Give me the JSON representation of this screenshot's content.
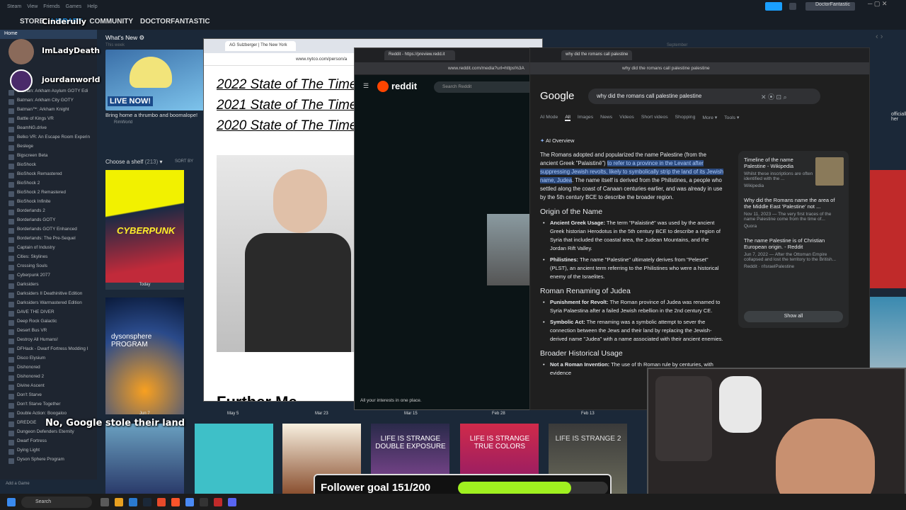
{
  "steam": {
    "menu": [
      "Steam",
      "View",
      "Friends",
      "Games",
      "Help"
    ],
    "nav": [
      "STORE",
      "LIBRARY",
      "COMMUNITY",
      "DOCTORFANTASTIC"
    ],
    "user": "DoctorFantastic",
    "home": "Home",
    "whats_new": "What's New ⚙",
    "this_week": "This week",
    "news_caption": "Bring home a thrumbo and boomalope!",
    "news_sub": "RimWorld",
    "live": "LIVE NOW!",
    "shelf": "Choose a shelf",
    "shelf_count": "(213)",
    "sort_by": "SORT BY",
    "month_labels": [
      "This week",
      "September"
    ],
    "dates": [
      "Today",
      "Jun 7",
      "May 5",
      "Mar 23",
      "Mar 15",
      "Feb 28",
      "Feb 13"
    ],
    "tile_titles": [
      "CYBERPUNK",
      "dysonsphere PROGRAM",
      "LIFE IS STRANGE DOUBLE EXPOSURE",
      "LIFE IS STRANGE TRUE COLORS",
      "LIFE IS STRANGE 2"
    ],
    "officially": "officially her",
    "add_game": "Add a Game",
    "games": [
      "Batman: Arkham Asylum GOTY Edi",
      "Batman: Arkham City GOTY",
      "Batman™: Arkham Knight",
      "Battle of Kings VR",
      "BeamNG.drive",
      "Belko VR: An Escape Room Experin",
      "Beslege",
      "Bigscreen Beta",
      "BioShock",
      "BioShock Remastered",
      "BioShock 2",
      "BioShock 2 Remastered",
      "BioShock Infinite",
      "Borderlands 2",
      "Borderlands GOTY",
      "Borderlands GOTY Enhanced",
      "Borderlands: The Pre-Sequel",
      "Captain of Industry",
      "Cities: Skylines",
      "Crossing Souls",
      "Cyberpunk 2077",
      "Darksiders",
      "Darksiders II Deathinitive Edition",
      "Darksiders Warmastered Edition",
      "DAVE THE DIVER",
      "Deep Rock Galactic",
      "Desert Bus VR",
      "Destroy All Humans!",
      "DFHack - Dwarf Fortress Modding I",
      "Disco Elysium",
      "Dishonored",
      "Dishonored 2",
      "Divine Ascent",
      "Don't Starve",
      "Don't Starve Together",
      "Double Action: Boogaloo",
      "DREDGE",
      "Dungeon Defenders Eternity",
      "Dwarf Fortress",
      "Dying Light",
      "Dyson Sphere Program"
    ]
  },
  "overlay": {
    "names": [
      "Cinderully",
      "ImLadyDeath",
      "jourdanworld"
    ],
    "chat": "No, Google stole their land",
    "follower_goal": "Follower goal 151/200",
    "follower_fraction": 0.755
  },
  "nyt": {
    "tab": "AG Sulzberger | The New York",
    "url": "www.nytco.com/person/a",
    "links": [
      "2022 State of The Times",
      "2021 State of The Times",
      "2020 State of The Times"
    ],
    "footer_cut": "Further Me"
  },
  "reddit": {
    "tab": "Reddit - https://preview.redd.it",
    "url": "www.reddit.com/media?url=https%3A",
    "logo": "reddit",
    "search": "Search Reddit",
    "footer": "All your interests in one place."
  },
  "google": {
    "tab": "why did the romans call palestine",
    "url": "why did the romans call palestine palestine",
    "query": "why did the romans call palestine palestine",
    "logo": "Google",
    "tabs": [
      "AI Mode",
      "All",
      "Images",
      "News",
      "Videos",
      "Short videos",
      "Shopping",
      "More ▾",
      "Tools ▾"
    ],
    "ai_title": "AI Overview",
    "intro_1": "The Romans adopted and popularized the name Palestine (from the ancient Greek \"Palaistinē\") ",
    "intro_hl": "to refer to a province in the Levant after suppressing Jewish revolts, likely to symbolically strip the land of its Jewish name, Judea",
    "intro_2": ". The name itself is derived from the Philistines, a people who settled along the coast of Canaan centuries earlier, and was already in use by the 5th century BCE to describe the broader region.",
    "h1": "Origin of the Name",
    "b1_t": "Ancient Greek Usage:",
    "b1": " The term \"Palaistinē\" was used by the ancient Greek historian Herodotus in the 5th century BCE to describe a region of Syria that included the coastal area, the Judean Mountains, and the Jordan Rift Valley.",
    "b2_t": "Philistines:",
    "b2": " The name \"Palestine\" ultimately derives from \"Peleset\" (PLST), an ancient term referring to the Philistines who were a historical enemy of the Israelites.",
    "h2": "Roman Renaming of Judea",
    "b3_t": "Punishment for Revolt:",
    "b3": " The Roman province of Judea was renamed to Syria Palaestina after a failed Jewish rebellion in the 2nd century CE.",
    "b4_t": "Symbolic Act:",
    "b4": " The renaming was a symbolic attempt to sever the connection between the Jews and their land by replacing the Jewish-derived name \"Judea\" with a name associated with their ancient enemies.",
    "h3": "Broader Historical Usage",
    "b5_t": "Not a Roman Invention:",
    "b5": " The use of th Roman rule by centuries, with evidence",
    "cards": [
      {
        "title": "Timeline of the name Palestine - Wikipedia",
        "snippet": "Whilst these inscriptions are often identified with the ...",
        "source": "Wikipedia"
      },
      {
        "title": "Why did the Romans name the area of the Middle East 'Palestine' not ...",
        "snippet": "Nov 11, 2023 — The very first traces of the name Palestine come from the time of...",
        "source": "Quora"
      },
      {
        "title": "The name Palestine is of Christian European origin. - Reddit",
        "snippet": "Jun 7, 2022 — After the Ottoman Empire collapsed and lost the territory to the British...",
        "source": "Reddit · r/IsraelPalestine"
      }
    ],
    "show_all": "Show all"
  },
  "taskbar": {
    "search": "Search"
  },
  "colors": {
    "steam_bg": "#1b2838",
    "google_bg": "#1f1f1f",
    "follower_bar": "#a0f020",
    "highlight": "#2b4a7f"
  }
}
